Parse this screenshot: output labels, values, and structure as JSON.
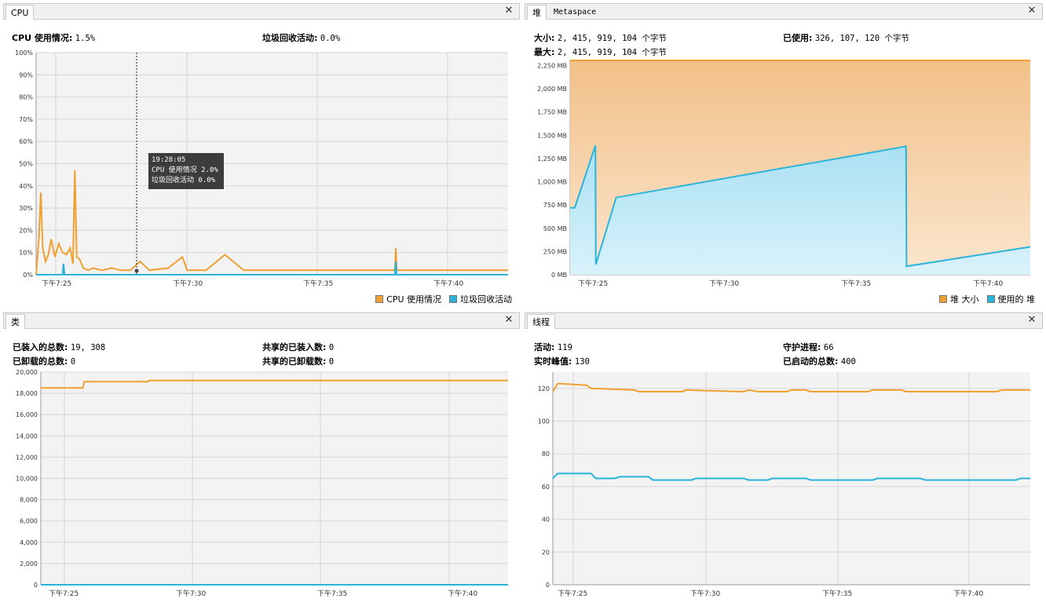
{
  "colors": {
    "orange": "#f0a030",
    "blue": "#2ab4dc",
    "grid": "#d6d6d6",
    "plotbg": "#f3f3f3"
  },
  "cpu": {
    "tab_label": "CPU",
    "close_icon": "close-icon",
    "cpu_usage_label": "CPU 使用情况:",
    "cpu_usage_value": "1.5%",
    "gc_label": "垃圾回收活动:",
    "gc_value": "0.0%",
    "tooltip": {
      "time": "19:28:05",
      "line1": "CPU 使用情况  2.0%",
      "line2": "垃圾回收活动  0.0%"
    },
    "legend": {
      "cpu": "CPU 使用情况",
      "gc": "垃圾回收活动"
    }
  },
  "heap": {
    "tab_label": "堆",
    "tab2_label": "Metaspace",
    "size_label": "大小:",
    "size_value": "2, 415, 919, 104 个字节",
    "max_label": "最大:",
    "max_value": "2, 415, 919, 104 个字节",
    "used_label": "已使用:",
    "used_value": "326, 107, 120 个字节",
    "legend": {
      "size": "堆 大小",
      "used": "使用的 堆"
    }
  },
  "classes": {
    "tab_label": "类",
    "loaded_label": "已装入的总数:",
    "loaded_value": "19, 308",
    "unloaded_label": "已卸载的总数:",
    "unloaded_value": "0",
    "shared_loaded_label": "共享的已装入数:",
    "shared_loaded_value": "0",
    "shared_unloaded_label": "共享的已卸载数:",
    "shared_unloaded_value": "0"
  },
  "threads": {
    "tab_label": "线程",
    "live_label": "活动:",
    "live_value": "119",
    "peak_label": "实时峰值:",
    "peak_value": "130",
    "daemon_label": "守护进程:",
    "daemon_value": "66",
    "started_label": "已启动的总数:",
    "started_value": "400"
  },
  "chart_data": [
    {
      "name": "cpu",
      "type": "line",
      "x_range": [
        19.3,
        19.72
      ],
      "x_ticks": [
        {
          "x": 19.417,
          "label": "下午7:25"
        },
        {
          "x": 19.5,
          "label": "下午7:30"
        },
        {
          "x": 19.583,
          "label": "下午7:35"
        },
        {
          "x": 19.667,
          "label": "下午7:40"
        }
      ],
      "ylim": [
        0,
        100
      ],
      "y_ticks": [
        "0%",
        "10%",
        "20%",
        "30%",
        "40%",
        "50%",
        "60%",
        "70%",
        "80%",
        "90%",
        "100%"
      ],
      "series": [
        {
          "name": "CPU 使用情况",
          "color": "orange",
          "values": [
            [
              0,
              0
            ],
            [
              0.3,
              17
            ],
            [
              0.5,
              37
            ],
            [
              0.7,
              12
            ],
            [
              1.0,
              6
            ],
            [
              1.3,
              9
            ],
            [
              1.6,
              16
            ],
            [
              2.0,
              8
            ],
            [
              2.4,
              14
            ],
            [
              2.8,
              10
            ],
            [
              3.2,
              9
            ],
            [
              3.6,
              12
            ],
            [
              3.9,
              5
            ],
            [
              4.1,
              47
            ],
            [
              4.3,
              8
            ],
            [
              4.6,
              7
            ],
            [
              5.0,
              3
            ],
            [
              5.5,
              2
            ],
            [
              6.0,
              3
            ],
            [
              7.0,
              2
            ],
            [
              8.0,
              3
            ],
            [
              9.0,
              2
            ],
            [
              10.0,
              2
            ],
            [
              11.0,
              6
            ],
            [
              12.0,
              2
            ],
            [
              14.0,
              3
            ],
            [
              15.5,
              8
            ],
            [
              16.0,
              2
            ],
            [
              18.0,
              2
            ],
            [
              20.0,
              9
            ],
            [
              22.0,
              2
            ],
            [
              25.0,
              2
            ],
            [
              30.0,
              2
            ],
            [
              35.0,
              2
            ],
            [
              38.0,
              2
            ],
            [
              38.1,
              12
            ],
            [
              38.2,
              2
            ],
            [
              42.0,
              2
            ],
            [
              45.0,
              2
            ],
            [
              48.0,
              2
            ],
            [
              50.0,
              2
            ]
          ],
          "x_unit": "relative_index_0_50"
        },
        {
          "name": "垃圾回收活动",
          "color": "blue",
          "values": [
            [
              0,
              0
            ],
            [
              2.8,
              0
            ],
            [
              2.9,
              5
            ],
            [
              3.0,
              0
            ],
            [
              38.0,
              0
            ],
            [
              38.1,
              6
            ],
            [
              38.2,
              0
            ],
            [
              50,
              0
            ]
          ],
          "x_unit": "relative_index_0_50"
        }
      ],
      "legend_position": "bottom-right",
      "grid": true
    },
    {
      "name": "heap",
      "type": "area",
      "ylim": [
        0,
        2304
      ],
      "y_ticks": [
        "0 MB",
        "250 MB",
        "500 MB",
        "750 MB",
        "1,000 MB",
        "1,250 MB",
        "1,500 MB",
        "1,750 MB",
        "2,000 MB",
        "2,250 MB"
      ],
      "x_ticks": [
        "下午7:25",
        "下午7:30",
        "下午7:35",
        "下午7:40"
      ],
      "series": [
        {
          "name": "堆 大小",
          "color": "orange",
          "values": [
            [
              0,
              2304
            ],
            [
              100,
              2304
            ]
          ]
        },
        {
          "name": "使用的 堆",
          "color": "blue",
          "values": [
            [
              0,
              720
            ],
            [
              1,
              720
            ],
            [
              5.5,
              1390
            ],
            [
              5.6,
              110
            ],
            [
              10,
              830
            ],
            [
              73,
              1380
            ],
            [
              73.1,
              90
            ],
            [
              100,
              300
            ]
          ]
        }
      ],
      "legend_position": "bottom-right",
      "grid": true
    },
    {
      "name": "classes",
      "type": "line",
      "ylim": [
        0,
        20000
      ],
      "y_ticks": [
        "0",
        "2,000",
        "4,000",
        "6,000",
        "8,000",
        "10,000",
        "12,000",
        "14,000",
        "16,000",
        "18,000",
        "20,000"
      ],
      "x_ticks": [
        "下午7:25",
        "下午7:30",
        "下午7:35",
        "下午7:40"
      ],
      "series": [
        {
          "name": "已装入",
          "color": "orange",
          "values": [
            [
              0,
              18500
            ],
            [
              9,
              18500
            ],
            [
              9.3,
              19100
            ],
            [
              23,
              19100
            ],
            [
              23.2,
              19200
            ],
            [
              100,
              19200
            ]
          ]
        },
        {
          "name": "共享",
          "color": "blue",
          "values": [
            [
              0,
              0
            ],
            [
              100,
              0
            ]
          ]
        }
      ],
      "grid": true
    },
    {
      "name": "threads",
      "type": "line",
      "ylim": [
        0,
        130
      ],
      "y_ticks": [
        "0",
        "20",
        "40",
        "60",
        "80",
        "100",
        "120"
      ],
      "x_ticks": [
        "下午7:25",
        "下午7:30",
        "下午7:35",
        "下午7:40"
      ],
      "series": [
        {
          "name": "活动",
          "color": "orange",
          "values": [
            [
              0,
              118
            ],
            [
              1,
              123
            ],
            [
              7,
              122
            ],
            [
              8,
              120
            ],
            [
              17,
              119
            ],
            [
              18,
              118
            ],
            [
              27,
              118
            ],
            [
              28,
              119
            ],
            [
              40,
              118
            ],
            [
              41,
              119
            ],
            [
              43,
              118
            ],
            [
              49,
              118
            ],
            [
              50,
              119
            ],
            [
              53,
              119
            ],
            [
              54,
              118
            ],
            [
              66,
              118
            ],
            [
              67,
              119
            ],
            [
              73,
              119
            ],
            [
              74,
              118
            ],
            [
              93,
              118
            ],
            [
              94,
              119
            ],
            [
              100,
              119
            ]
          ]
        },
        {
          "name": "守护",
          "color": "blue",
          "values": [
            [
              0,
              65
            ],
            [
              1,
              68
            ],
            [
              8,
              68
            ],
            [
              9,
              65
            ],
            [
              13,
              65
            ],
            [
              14,
              66
            ],
            [
              20,
              66
            ],
            [
              21,
              64
            ],
            [
              29,
              64
            ],
            [
              30,
              65
            ],
            [
              40,
              65
            ],
            [
              41,
              64
            ],
            [
              45,
              64
            ],
            [
              46,
              65
            ],
            [
              53,
              65
            ],
            [
              54,
              64
            ],
            [
              67,
              64
            ],
            [
              68,
              65
            ],
            [
              77,
              65
            ],
            [
              78,
              64
            ],
            [
              97,
              64
            ],
            [
              98,
              65
            ],
            [
              100,
              65
            ]
          ]
        }
      ],
      "grid": true
    }
  ]
}
